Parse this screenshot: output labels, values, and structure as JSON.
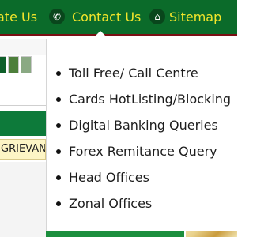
{
  "nav": {
    "left_partial": "ate Us",
    "contact": "Contact Us",
    "sitemap": "Sitemap",
    "phone_icon": "phone-icon",
    "home_icon": "home-icon"
  },
  "colors": {
    "nav_bg": "#0b6b2a",
    "nav_text": "#f2e52b",
    "nav_border": "#7a0f14"
  },
  "left": {
    "grievance_partial": "GRIEVAN"
  },
  "dropdown": {
    "items": [
      {
        "label": "Toll Free/ Call Centre"
      },
      {
        "label": "Cards HotListing/Blocking"
      },
      {
        "label": "Digital Banking Queries"
      },
      {
        "label": "Forex Remitance Query"
      },
      {
        "label": "Head Offices"
      },
      {
        "label": "Zonal Offices"
      }
    ]
  }
}
